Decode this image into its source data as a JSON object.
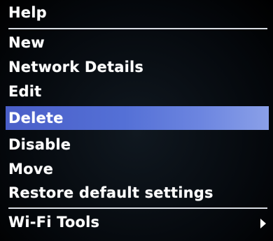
{
  "menu": {
    "header": "Help",
    "items": [
      {
        "label": "New"
      },
      {
        "label": "Network Details"
      },
      {
        "label": "Edit"
      },
      {
        "label": "Delete",
        "selected": true
      },
      {
        "label": "Disable"
      },
      {
        "label": "Move"
      },
      {
        "label": "Restore default settings"
      }
    ],
    "submenu_item": {
      "label": "Wi-Fi Tools",
      "icon": "chevron-right-icon"
    },
    "colors": {
      "background": "#000000",
      "text": "#ffffff",
      "highlight": "#5470d6",
      "separator": "#d8dce2"
    }
  }
}
